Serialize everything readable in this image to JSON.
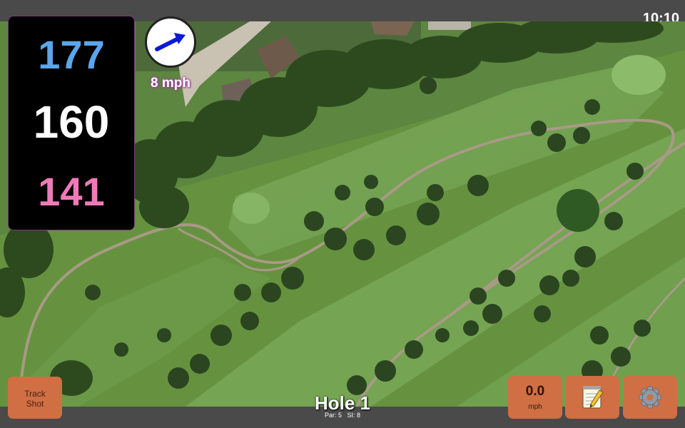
{
  "status": {
    "time": "10:10"
  },
  "yardage": {
    "back": "177",
    "middle": "160",
    "front": "141"
  },
  "wind": {
    "speed": "8 mph",
    "direction_icon": "arrow-right-icon"
  },
  "hole": {
    "title": "Hole 1",
    "par": "Par: 5",
    "si": "SI: 8"
  },
  "buttons": {
    "track_shot_line1": "Track",
    "track_shot_line2": "Shot",
    "speed_value": "0.0",
    "speed_unit": "mph",
    "notes_icon": "notepad-icon",
    "settings_icon": "gear-icon"
  },
  "colors": {
    "back_yardage": "#5aa6ec",
    "middle_yardage": "#ffffff",
    "front_yardage": "#f07ab8",
    "button": "#cf6f43",
    "bar": "#4a4a4a"
  }
}
